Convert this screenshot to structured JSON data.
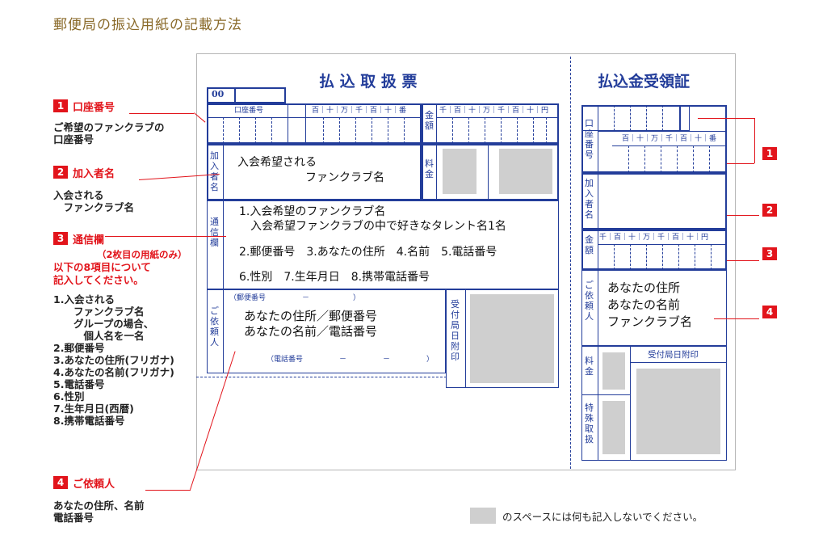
{
  "page_title": "郵便局の振込用紙の記載方法",
  "notes": {
    "n1": {
      "num": "1",
      "head": "口座番号",
      "text": "ご希望のファンクラブの\n口座番号"
    },
    "n2": {
      "num": "2",
      "head": "加入者名",
      "text": "入会される\n　ファンクラブ名"
    },
    "n3": {
      "num": "3",
      "head": "通信欄",
      "sub": "（2枚目の用紙のみ）",
      "red_text": "以下の8項目について\n記入してください。",
      "list": "1.入会される\n　　ファンクラブ名\n　　グループの場合、\n　　　個人名を一名\n2.郵便番号\n3.あなたの住所(フリガナ)\n4.あなたの名前(フリガナ)\n5.電話番号\n6.性別\n7.生年月日(西暦)\n8.携帯電話番号"
    },
    "n4": {
      "num": "4",
      "head": "ご依頼人",
      "text": "あなたの住所、名前\n電話番号"
    }
  },
  "form_left": {
    "title": "払 込 取 扱 票",
    "code": "00",
    "account_label": "口座番号",
    "digits_label": "百｜十｜万｜千｜百｜十｜番",
    "amount_label": "金額",
    "amount_digits": "千｜百｜十｜万｜千｜百｜十｜円",
    "subscriber_label": "加入者名",
    "subscriber_text": "入会希望される\n　　　　　　ファンクラブ名",
    "fee_label": "料金",
    "comm_label": "通信欄",
    "comm_text": "1.入会希望のファンクラブ名\n　入会希望ファンクラブの中で好きなタレント名1名",
    "comm_text2": "2.郵便番号　3.あなたの住所　4.名前　5.電話番号",
    "comm_text3": "6.性別　7.生年月日　8.携帯電話番号",
    "requester_label": "ご依頼人",
    "postal_label": "（郵便番号　　　　　－　　　　　　）",
    "requester_text": "あなたの住所／郵便番号\nあなたの名前／電話番号",
    "phone_label": "（電話番号　　　　　－　　　　　－　　　　　）",
    "stamp_label": "受付局日附印"
  },
  "form_right": {
    "title": "払込金受領証",
    "account_label": "口座番号",
    "digits_label": "百｜十｜万｜千｜百｜十｜番",
    "subscriber_label": "加入者名",
    "amount_label": "金額",
    "amount_digits": "千｜百｜十｜万｜千｜百｜十｜円",
    "requester_label": "ご依頼人",
    "requester_text": "あなたの住所\nあなたの名前\nファンクラブ名",
    "fee_label": "料金",
    "special_label": "特殊取扱",
    "stamp_label": "受付局日附印"
  },
  "callouts": [
    "1",
    "2",
    "3",
    "4"
  ],
  "legend_text": "のスペースには何も記入しないでください。",
  "colors": {
    "form_blue": "#233d9a",
    "accent_red": "#e2141b",
    "title_brown": "#8a6a2a",
    "blank_gray": "#cfcfcf"
  }
}
